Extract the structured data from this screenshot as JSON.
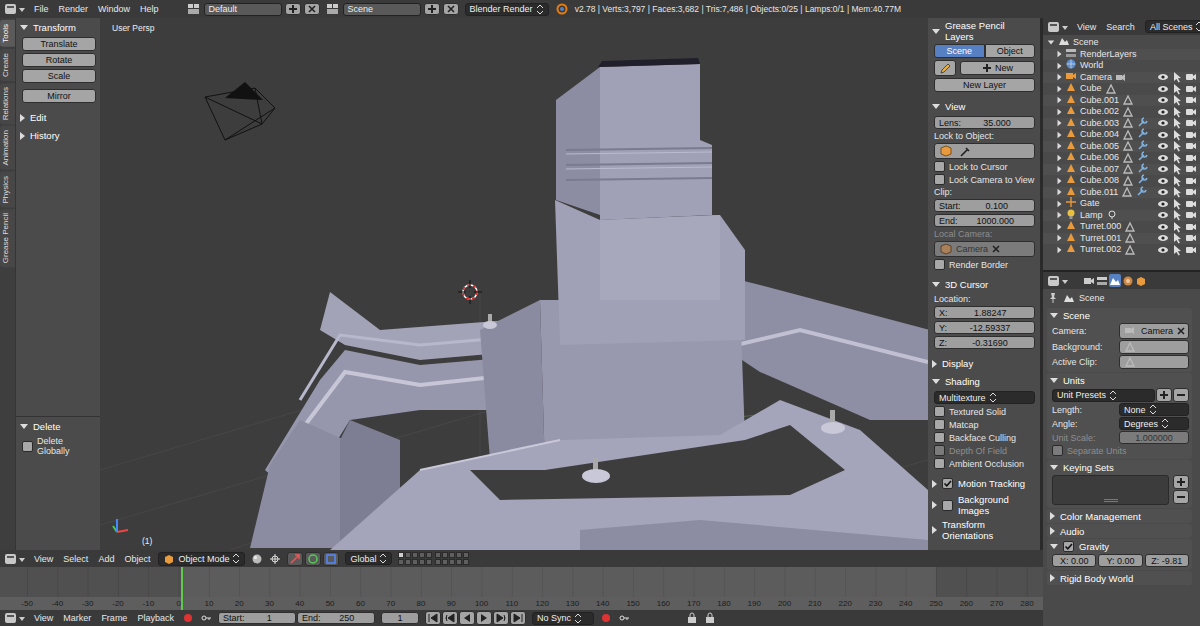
{
  "top_bar": {
    "menus": [
      "File",
      "Render",
      "Window",
      "Help"
    ],
    "layout": "Default",
    "scene": "Scene",
    "engine": "Blender Render",
    "stats": "v2.78 | Verts:3,797 | Faces:3,682 | Tris:7,486 | Objects:0/25 | Lamps:0/1 | Mem:40.77M"
  },
  "tool_tabs": [
    {
      "label": "Tools",
      "selected": true
    },
    {
      "label": "Create",
      "selected": false
    },
    {
      "label": "Relations",
      "selected": false
    },
    {
      "label": "Animation",
      "selected": false
    },
    {
      "label": "Physics",
      "selected": false
    },
    {
      "label": "Grease Pencil",
      "selected": false
    }
  ],
  "tool_shelf": {
    "panels": [
      {
        "title": "Transform",
        "expanded": true,
        "buttons": [
          "Translate",
          "Rotate",
          "Scale",
          "Mirror"
        ]
      },
      {
        "title": "Edit",
        "expanded": false,
        "buttons": []
      },
      {
        "title": "History",
        "expanded": false,
        "buttons": []
      }
    ]
  },
  "operator_panel": {
    "title": "Delete",
    "expanded": true,
    "options": [
      {
        "label": "Delete Globally",
        "checked": false
      }
    ]
  },
  "viewport": {
    "view_label": "User Persp",
    "frame_label": "(1)"
  },
  "n_panel": {
    "panels": [
      {
        "title": "Grease Pencil Layers",
        "kind": "plain",
        "expanded": true,
        "rows": [
          {
            "kind": "tabs",
            "disabled": false,
            "tabs": [
              {
                "label": "Scene",
                "selected": true
              },
              {
                "label": "Object",
                "selected": false
              }
            ]
          },
          {
            "kind": "new",
            "label": "New",
            "disabled": false
          },
          {
            "kind": "button",
            "label": "New Layer",
            "disabled": false
          }
        ]
      },
      {
        "title": "View",
        "kind": "plain",
        "expanded": true,
        "rows": [
          {
            "kind": "field",
            "label": "Lens:",
            "value": "35.000",
            "disabled": false
          },
          {
            "kind": "label",
            "label": "Lock to Object:",
            "disabled": false
          },
          {
            "kind": "object-field",
            "disabled": false
          },
          {
            "kind": "checkbox",
            "label": "Lock to Cursor",
            "checked": false,
            "disabled": false
          },
          {
            "kind": "checkbox",
            "label": "Lock Camera to View",
            "checked": false,
            "disabled": false
          },
          {
            "kind": "label",
            "label": "Clip:",
            "disabled": false
          },
          {
            "kind": "field",
            "label": "Start:",
            "value": "0.100",
            "disabled": false
          },
          {
            "kind": "field",
            "label": "End:",
            "value": "1000.000",
            "disabled": false
          },
          {
            "kind": "label",
            "label": "Local Camera:",
            "disabled": true
          },
          {
            "kind": "object-field",
            "value": "Camera",
            "disabled": true
          },
          {
            "kind": "checkbox",
            "label": "Render Border",
            "checked": false,
            "disabled": false
          }
        ]
      },
      {
        "title": "3D Cursor",
        "kind": "plain",
        "expanded": true,
        "rows": [
          {
            "kind": "label",
            "label": "Location:",
            "disabled": false
          },
          {
            "kind": "field",
            "label": "X:",
            "value": "1.88247",
            "disabled": false
          },
          {
            "kind": "field",
            "label": "Y:",
            "value": "-12.59337",
            "disabled": false
          },
          {
            "kind": "field",
            "label": "Z:",
            "value": "-0.31690",
            "disabled": false
          }
        ]
      },
      {
        "title": "Display",
        "kind": "plain",
        "expanded": false,
        "rows": []
      },
      {
        "title": "Shading",
        "kind": "plain",
        "expanded": true,
        "rows": [
          {
            "kind": "dropdown",
            "value": "Multitexture",
            "disabled": false
          },
          {
            "kind": "checkbox",
            "label": "Textured Solid",
            "checked": false,
            "disabled": false
          },
          {
            "kind": "checkbox",
            "label": "Matcap",
            "checked": false,
            "disabled": false
          },
          {
            "kind": "checkbox",
            "label": "Backface Culling",
            "checked": false,
            "disabled": false
          },
          {
            "kind": "checkbox",
            "label": "Depth Of Field",
            "checked": false,
            "disabled": true
          },
          {
            "kind": "checkbox",
            "label": "Ambient Occlusion",
            "checked": false,
            "disabled": false
          }
        ]
      },
      {
        "title": "Motion Tracking",
        "kind": "toggle",
        "checked": true,
        "expanded": false,
        "rows": []
      },
      {
        "title": "Background Images",
        "kind": "toggle",
        "checked": false,
        "expanded": false,
        "rows": []
      },
      {
        "title": "Transform Orientations",
        "kind": "plain",
        "expanded": false,
        "rows": []
      }
    ]
  },
  "outliner": {
    "menus": [
      "View",
      "Search"
    ],
    "filter": "All Scenes",
    "items": [
      {
        "label": "Scene",
        "kind": "scene",
        "expanded": true,
        "restrict": false,
        "modifier": false,
        "children": [
          {
            "label": "RenderLayers",
            "kind": "renderlayers",
            "expanded": false,
            "restrict": false,
            "modifier": false
          },
          {
            "label": "World",
            "kind": "world",
            "expanded": false,
            "restrict": false,
            "modifier": false
          },
          {
            "label": "Camera",
            "kind": "camera",
            "expanded": false,
            "restrict": true,
            "modifier": false
          },
          {
            "label": "Cube",
            "kind": "mesh",
            "expanded": false,
            "restrict": true,
            "modifier": false
          },
          {
            "label": "Cube.001",
            "kind": "mesh",
            "expanded": false,
            "restrict": true,
            "modifier": false
          },
          {
            "label": "Cube.002",
            "kind": "mesh",
            "expanded": false,
            "restrict": true,
            "modifier": false
          },
          {
            "label": "Cube.003",
            "kind": "mesh",
            "expanded": false,
            "restrict": true,
            "modifier": true
          },
          {
            "label": "Cube.004",
            "kind": "mesh",
            "expanded": false,
            "restrict": true,
            "modifier": true
          },
          {
            "label": "Cube.005",
            "kind": "mesh",
            "expanded": false,
            "restrict": true,
            "modifier": true
          },
          {
            "label": "Cube.006",
            "kind": "mesh",
            "expanded": false,
            "restrict": true,
            "modifier": true
          },
          {
            "label": "Cube.007",
            "kind": "mesh",
            "expanded": false,
            "restrict": true,
            "modifier": true
          },
          {
            "label": "Cube.008",
            "kind": "mesh",
            "expanded": false,
            "restrict": true,
            "modifier": true
          },
          {
            "label": "Cube.011",
            "kind": "mesh",
            "expanded": false,
            "restrict": true,
            "modifier": true
          },
          {
            "label": "Gate",
            "kind": "empty",
            "expanded": false,
            "restrict": true,
            "modifier": false
          },
          {
            "label": "Lamp",
            "kind": "lamp",
            "expanded": false,
            "restrict": true,
            "modifier": false
          },
          {
            "label": "Turret.000",
            "kind": "mesh",
            "expanded": false,
            "restrict": true,
            "modifier": false
          },
          {
            "label": "Turret.001",
            "kind": "mesh",
            "expanded": false,
            "restrict": true,
            "modifier": false
          },
          {
            "label": "Turret.002",
            "kind": "mesh",
            "expanded": false,
            "restrict": true,
            "modifier": false
          }
        ]
      }
    ]
  },
  "properties": {
    "tabs": [
      {
        "selected": false
      },
      {
        "selected": false
      },
      {
        "selected": true
      },
      {
        "selected": false
      },
      {
        "selected": false
      }
    ],
    "breadcrumb": "Scene",
    "panels": [
      {
        "title": "Scene",
        "kind": "plain",
        "expanded": true,
        "rows": [
          {
            "kind": "labeled-object",
            "label": "Camera:",
            "value": "Camera",
            "disabled": false
          },
          {
            "kind": "labeled-empty",
            "label": "Background:",
            "disabled": false
          },
          {
            "kind": "labeled-empty",
            "label": "Active Clip:",
            "disabled": false
          }
        ]
      },
      {
        "title": "Units",
        "kind": "plain",
        "expanded": true,
        "rows": [
          {
            "kind": "presets",
            "value": "Unit Presets",
            "disabled": false
          },
          {
            "kind": "labeled-dropdown",
            "label": "Length:",
            "value": "None",
            "disabled": false
          },
          {
            "kind": "labeled-dropdown",
            "label": "Angle:",
            "value": "Degrees",
            "disabled": false
          },
          {
            "kind": "labeled-field",
            "label": "Unit Scale:",
            "value": "1.000000",
            "disabled": true
          },
          {
            "kind": "checkbox",
            "label": "Separate Units",
            "checked": false,
            "disabled": true
          }
        ]
      },
      {
        "title": "Keying Sets",
        "kind": "plain",
        "expanded": true,
        "rows": [
          {
            "kind": "list",
            "disabled": false
          }
        ]
      },
      {
        "title": "Color Management",
        "kind": "plain",
        "expanded": false,
        "rows": []
      },
      {
        "title": "Audio",
        "kind": "plain",
        "expanded": false,
        "rows": []
      },
      {
        "title": "Gravity",
        "kind": "toggle",
        "checked": true,
        "expanded": true,
        "rows": [
          {
            "kind": "vector",
            "values": [
              "X: 0.00",
              "Y: 0.00",
              "Z: -9.81"
            ],
            "disabled": false
          }
        ]
      },
      {
        "title": "Rigid Body World",
        "kind": "plain",
        "expanded": false,
        "rows": []
      }
    ]
  },
  "viewport_header": {
    "menus": [
      "View",
      "Select",
      "Add",
      "Object"
    ],
    "mode": "Object Mode",
    "orientation": "Global",
    "layers": [
      {
        "selected": true
      },
      {
        "selected": false
      },
      {
        "selected": false
      },
      {
        "selected": false
      },
      {
        "selected": false
      },
      {
        "selected": false
      },
      {
        "selected": false
      },
      {
        "selected": false
      },
      {
        "selected": false
      },
      {
        "selected": false
      },
      {
        "selected": false
      },
      {
        "selected": false
      },
      {
        "selected": false
      },
      {
        "selected": false
      },
      {
        "selected": false
      },
      {
        "selected": false
      },
      {
        "selected": false
      },
      {
        "selected": false
      },
      {
        "selected": false
      },
      {
        "selected": false
      }
    ]
  },
  "timeline": {
    "ticks": [
      "-50",
      "-40",
      "-30",
      "-20",
      "-10",
      "0",
      "10",
      "20",
      "30",
      "40",
      "50",
      "60",
      "70",
      "80",
      "90",
      "100",
      "110",
      "120",
      "130",
      "140",
      "150",
      "160",
      "170",
      "180",
      "190",
      "200",
      "210",
      "220",
      "230",
      "240",
      "250",
      "260",
      "270",
      "280"
    ]
  },
  "timeline_header": {
    "menus": [
      "View",
      "Marker",
      "Frame",
      "Playback"
    ],
    "start_label": "Start:",
    "start": "1",
    "end_label": "End:",
    "end": "250",
    "frame": "1",
    "sync": "No Sync"
  }
}
